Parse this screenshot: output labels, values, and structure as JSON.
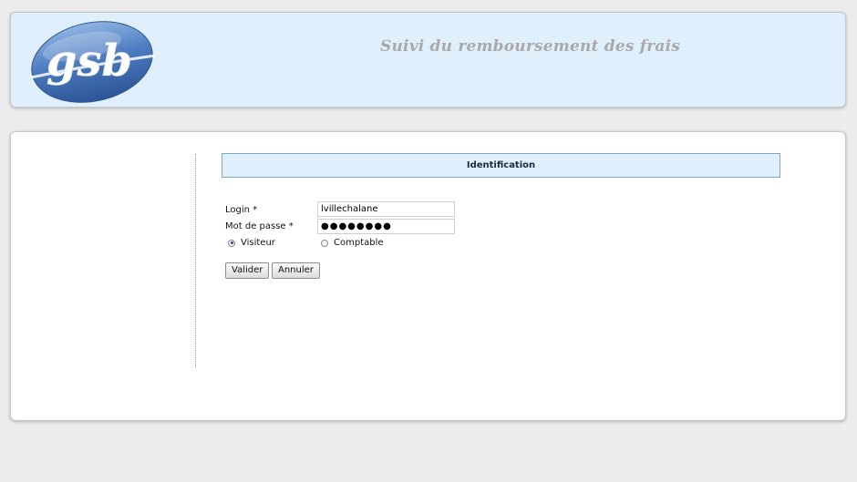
{
  "header": {
    "logo_text": "gsb",
    "title": "Suivi du remboursement des frais"
  },
  "form": {
    "section_title": "Identification",
    "login_label": "Login *",
    "login_value": "lvillechalane",
    "password_label": "Mot de passe *",
    "password_value": "●●●●●●●●",
    "roles": [
      {
        "label": "Visiteur",
        "checked": true
      },
      {
        "label": "Comptable",
        "checked": false
      }
    ],
    "submit_label": "Valider",
    "cancel_label": "Annuler"
  },
  "colors": {
    "header_bg": "#dfeffb",
    "section_border": "#7aa6cc",
    "logo_blue": "#3d6db3"
  },
  "icons": [
    "gsb-logo",
    "radio-checked-icon",
    "radio-unchecked-icon"
  ]
}
